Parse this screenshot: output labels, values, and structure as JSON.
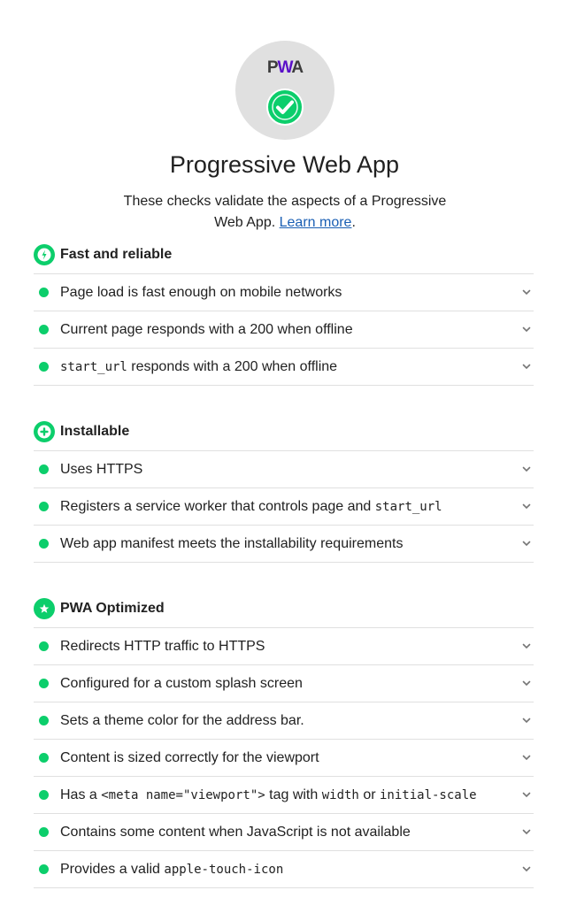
{
  "header": {
    "logo_text": "PWA",
    "title": "Progressive Web App",
    "description": "These checks validate the aspects of a Progressive Web App.",
    "learn_more": "Learn more",
    "period": "."
  },
  "colors": {
    "pass": "#0cce6b",
    "link": "#1a5fb4",
    "gauge_bg": "#e0e0e0"
  },
  "groups": [
    {
      "title": "Fast and reliable",
      "icon": "lightning-icon",
      "audits": [
        {
          "parts": [
            {
              "t": "Page load is fast enough on mobile networks",
              "code": false
            }
          ]
        },
        {
          "parts": [
            {
              "t": "Current page responds with a 200 when offline",
              "code": false
            }
          ]
        },
        {
          "parts": [
            {
              "t": "start_url",
              "code": true
            },
            {
              "t": " responds with a 200 when offline",
              "code": false
            }
          ]
        }
      ]
    },
    {
      "title": "Installable",
      "icon": "plus-icon",
      "audits": [
        {
          "parts": [
            {
              "t": "Uses HTTPS",
              "code": false
            }
          ]
        },
        {
          "parts": [
            {
              "t": "Registers a service worker that controls page and ",
              "code": false
            },
            {
              "t": "start_url",
              "code": true
            }
          ]
        },
        {
          "parts": [
            {
              "t": "Web app manifest meets the installability requirements",
              "code": false
            }
          ]
        }
      ]
    },
    {
      "title": "PWA Optimized",
      "icon": "star-icon",
      "audits": [
        {
          "parts": [
            {
              "t": "Redirects HTTP traffic to HTTPS",
              "code": false
            }
          ]
        },
        {
          "parts": [
            {
              "t": "Configured for a custom splash screen",
              "code": false
            }
          ]
        },
        {
          "parts": [
            {
              "t": "Sets a theme color for the address bar.",
              "code": false
            }
          ]
        },
        {
          "parts": [
            {
              "t": "Content is sized correctly for the viewport",
              "code": false
            }
          ]
        },
        {
          "parts": [
            {
              "t": "Has a ",
              "code": false
            },
            {
              "t": "<meta name=\"viewport\">",
              "code": true
            },
            {
              "t": " tag with ",
              "code": false
            },
            {
              "t": "width",
              "code": true
            },
            {
              "t": " or ",
              "code": false
            },
            {
              "t": "initial-scale",
              "code": true
            }
          ]
        },
        {
          "parts": [
            {
              "t": "Contains some content when JavaScript is not available",
              "code": false
            }
          ]
        },
        {
          "parts": [
            {
              "t": "Provides a valid ",
              "code": false
            },
            {
              "t": "apple-touch-icon",
              "code": true
            }
          ]
        }
      ]
    }
  ]
}
